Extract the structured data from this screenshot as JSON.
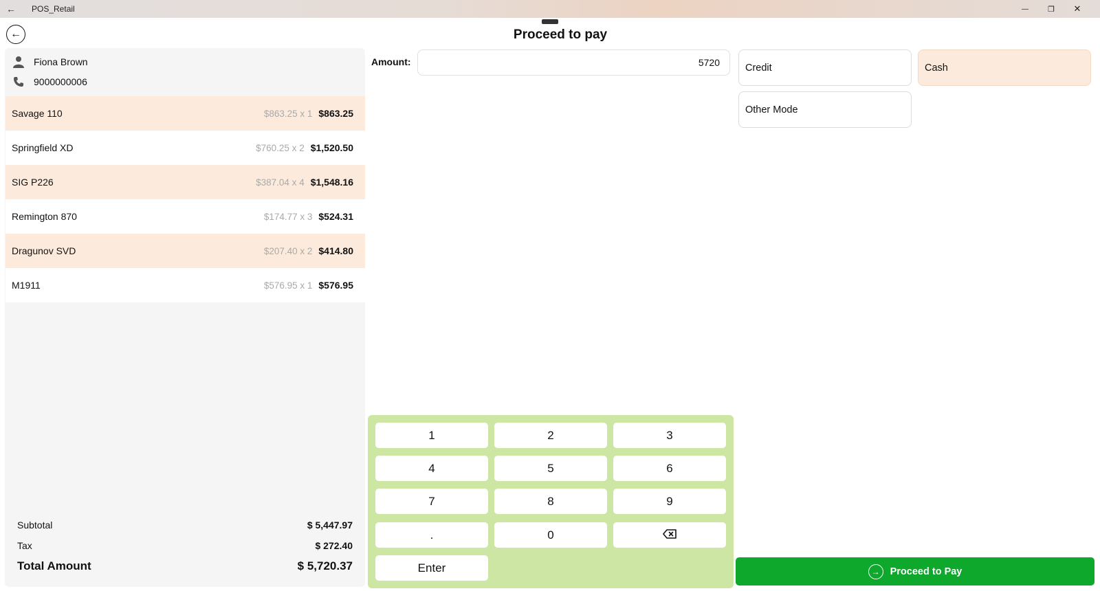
{
  "window": {
    "title": "POS_Retail",
    "back_glyph": "←",
    "minimize_glyph": "—",
    "restore_glyph": "❐",
    "close_glyph": "✕"
  },
  "header": {
    "title": "Proceed to pay",
    "back_glyph": "←"
  },
  "customer": {
    "name": "Fiona Brown",
    "phone": "9000000006"
  },
  "items": [
    {
      "name": "Savage 110",
      "unit": "$863.25 x 1",
      "total": "$863.25"
    },
    {
      "name": "Springfield XD",
      "unit": "$760.25 x 2",
      "total": "$1,520.50"
    },
    {
      "name": "SIG P226",
      "unit": "$387.04 x 4",
      "total": "$1,548.16"
    },
    {
      "name": "Remington 870",
      "unit": "$174.77 x 3",
      "total": "$524.31"
    },
    {
      "name": "Dragunov SVD",
      "unit": "$207.40 x 2",
      "total": "$414.80"
    },
    {
      "name": "M1911",
      "unit": "$576.95 x 1",
      "total": "$576.95"
    }
  ],
  "summary": {
    "subtotal_label": "Subtotal",
    "subtotal_value": "$ 5,447.97",
    "tax_label": "Tax",
    "tax_value": "$ 272.40",
    "total_label": "Total Amount",
    "total_value": "$ 5,720.37"
  },
  "amount": {
    "label": "Amount:",
    "value": "5720"
  },
  "keypad": {
    "keys": [
      "1",
      "2",
      "3",
      "4",
      "5",
      "6",
      "7",
      "8",
      "9",
      ".",
      "0"
    ],
    "enter_label": "Enter"
  },
  "payment_modes": [
    {
      "label": "Credit",
      "selected": false
    },
    {
      "label": "Cash",
      "selected": true
    },
    {
      "label": "Other Mode",
      "selected": false
    }
  ],
  "proceed": {
    "label": "Proceed to Pay",
    "glyph": "→"
  },
  "colors": {
    "accent_green": "#0ea82d",
    "keypad_bg": "#cee6a3",
    "highlight": "#fcebdc"
  }
}
